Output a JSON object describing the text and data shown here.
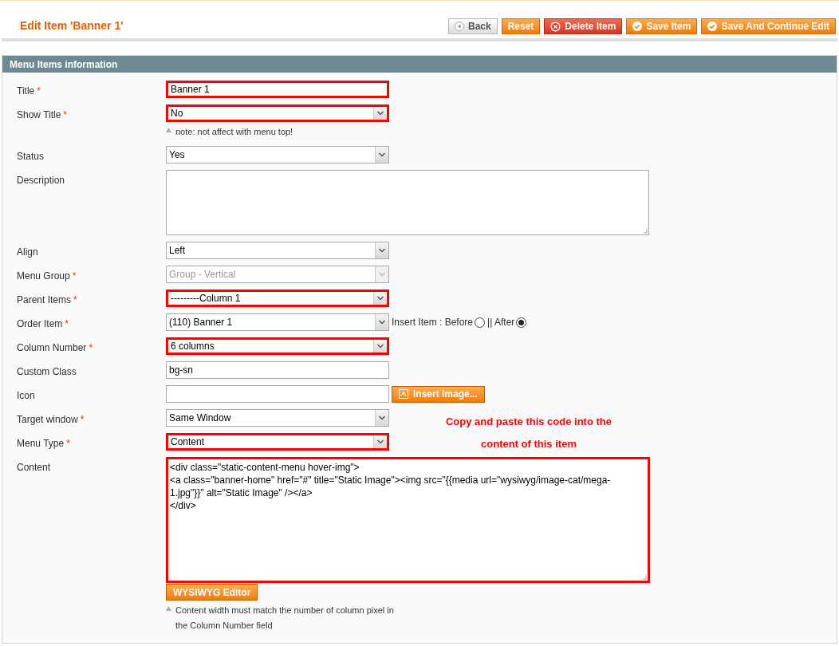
{
  "page_title": "Edit Item 'Banner 1'",
  "buttons": [
    {
      "label": "Back",
      "kind": "back"
    },
    {
      "label": "Reset",
      "kind": "reset"
    },
    {
      "label": "Delete Item",
      "kind": "delete"
    },
    {
      "label": "Save Item",
      "kind": "save"
    },
    {
      "label": "Save And Continue Edit",
      "kind": "save"
    }
  ],
  "section_title": "Menu Items information",
  "fields": [
    {
      "label": "Title",
      "required": "*",
      "kind": "text",
      "value": "Banner 1",
      "highlighted": true
    },
    {
      "label": "Show Title",
      "required": "*",
      "kind": "select",
      "value": "No",
      "highlighted": true,
      "note": "note: not affect with menu top!"
    },
    {
      "label": "Status",
      "kind": "select",
      "value": "Yes",
      "highlighted": false
    },
    {
      "label": "Description",
      "kind": "textarea",
      "highlighted": false
    },
    {
      "label": "Align",
      "kind": "select",
      "value": "Left",
      "highlighted": false
    },
    {
      "label": "Menu Group",
      "required": "*",
      "kind": "select",
      "value": "Group - Vertical",
      "highlighted": false,
      "disabled": true
    },
    {
      "label": "Parent Items",
      "required": "*",
      "kind": "select",
      "value": "---------Column 1",
      "highlighted": true
    },
    {
      "label": "Order Item",
      "required": "*",
      "kind": "select",
      "value": "(110) Banner 1",
      "highlighted": false,
      "insert_options": [
        {
          "label": "Insert Item : Before",
          "selected": false
        },
        {
          "label": "|| After",
          "selected": true
        }
      ]
    },
    {
      "label": "Column Number",
      "required": "*",
      "kind": "select",
      "value": "6 columns",
      "highlighted": true
    },
    {
      "label": "Custom Class",
      "kind": "text",
      "value": "bg-sn",
      "highlighted": false
    },
    {
      "label": "Icon",
      "kind": "text",
      "highlighted": false,
      "button": "Insert Image..."
    },
    {
      "label": "Target window",
      "required": "*",
      "kind": "select",
      "value": "Same Window",
      "highlighted": false
    },
    {
      "label": "Menu Type",
      "required": "*",
      "kind": "select",
      "value": "Content",
      "highlighted": true
    },
    {
      "label": "Content",
      "kind": "textarea",
      "highlighted": true,
      "value": "<div class=\"static-content-menu hover-img\">\n<a class=\"banner-home\" href=\"#\" title=\"Static Image\"><img src=\"{{media url=\"wysiwyg/image-cat/mega-1.jpg\"}}\" alt=\"Static Image\" /></a>\n</div>",
      "button": "WYSIWYG Editor",
      "note": "Content width must match the number of column pixel in the Column Number field"
    }
  ],
  "annotation": [
    "Copy and paste this code into the",
    "content of this item"
  ]
}
